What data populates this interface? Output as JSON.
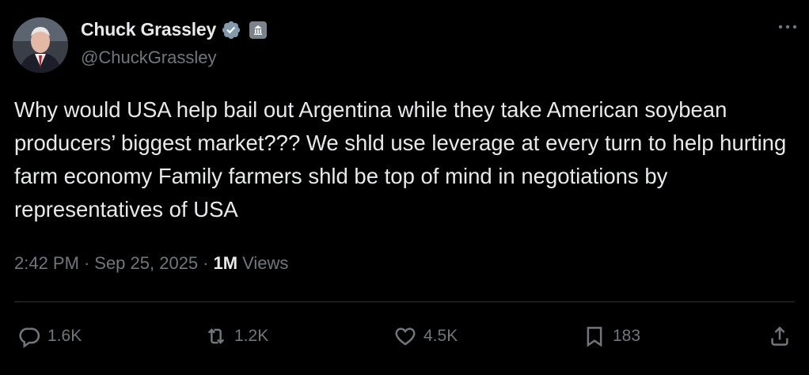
{
  "author": {
    "display_name": "Chuck Grassley",
    "handle": "@ChuckGrassley",
    "verified": true,
    "affiliation_badge": "government-building-icon"
  },
  "tweet": {
    "text": "Why would USA help bail out Argentina while they take American soybean producers’ biggest market??? We shld use leverage at every turn to help hurting farm economy Family farmers shld be top of mind in negotiations by representatives of USA",
    "time": "2:42 PM",
    "date": "Sep 25, 2025",
    "separator": "·",
    "views_count": "1M",
    "views_label": "Views"
  },
  "actions": {
    "reply_count": "1.6K",
    "retweet_count": "1.2K",
    "like_count": "4.5K",
    "bookmark_count": "183"
  },
  "icons": {
    "more": "more-dots-icon",
    "reply": "reply-icon",
    "retweet": "retweet-icon",
    "like": "heart-icon",
    "bookmark": "bookmark-icon",
    "share": "share-icon"
  },
  "colors": {
    "background": "#000000",
    "text": "#e7e9ea",
    "muted": "#71767b",
    "verified_badge": "#829aab",
    "divider": "#2f3336"
  }
}
